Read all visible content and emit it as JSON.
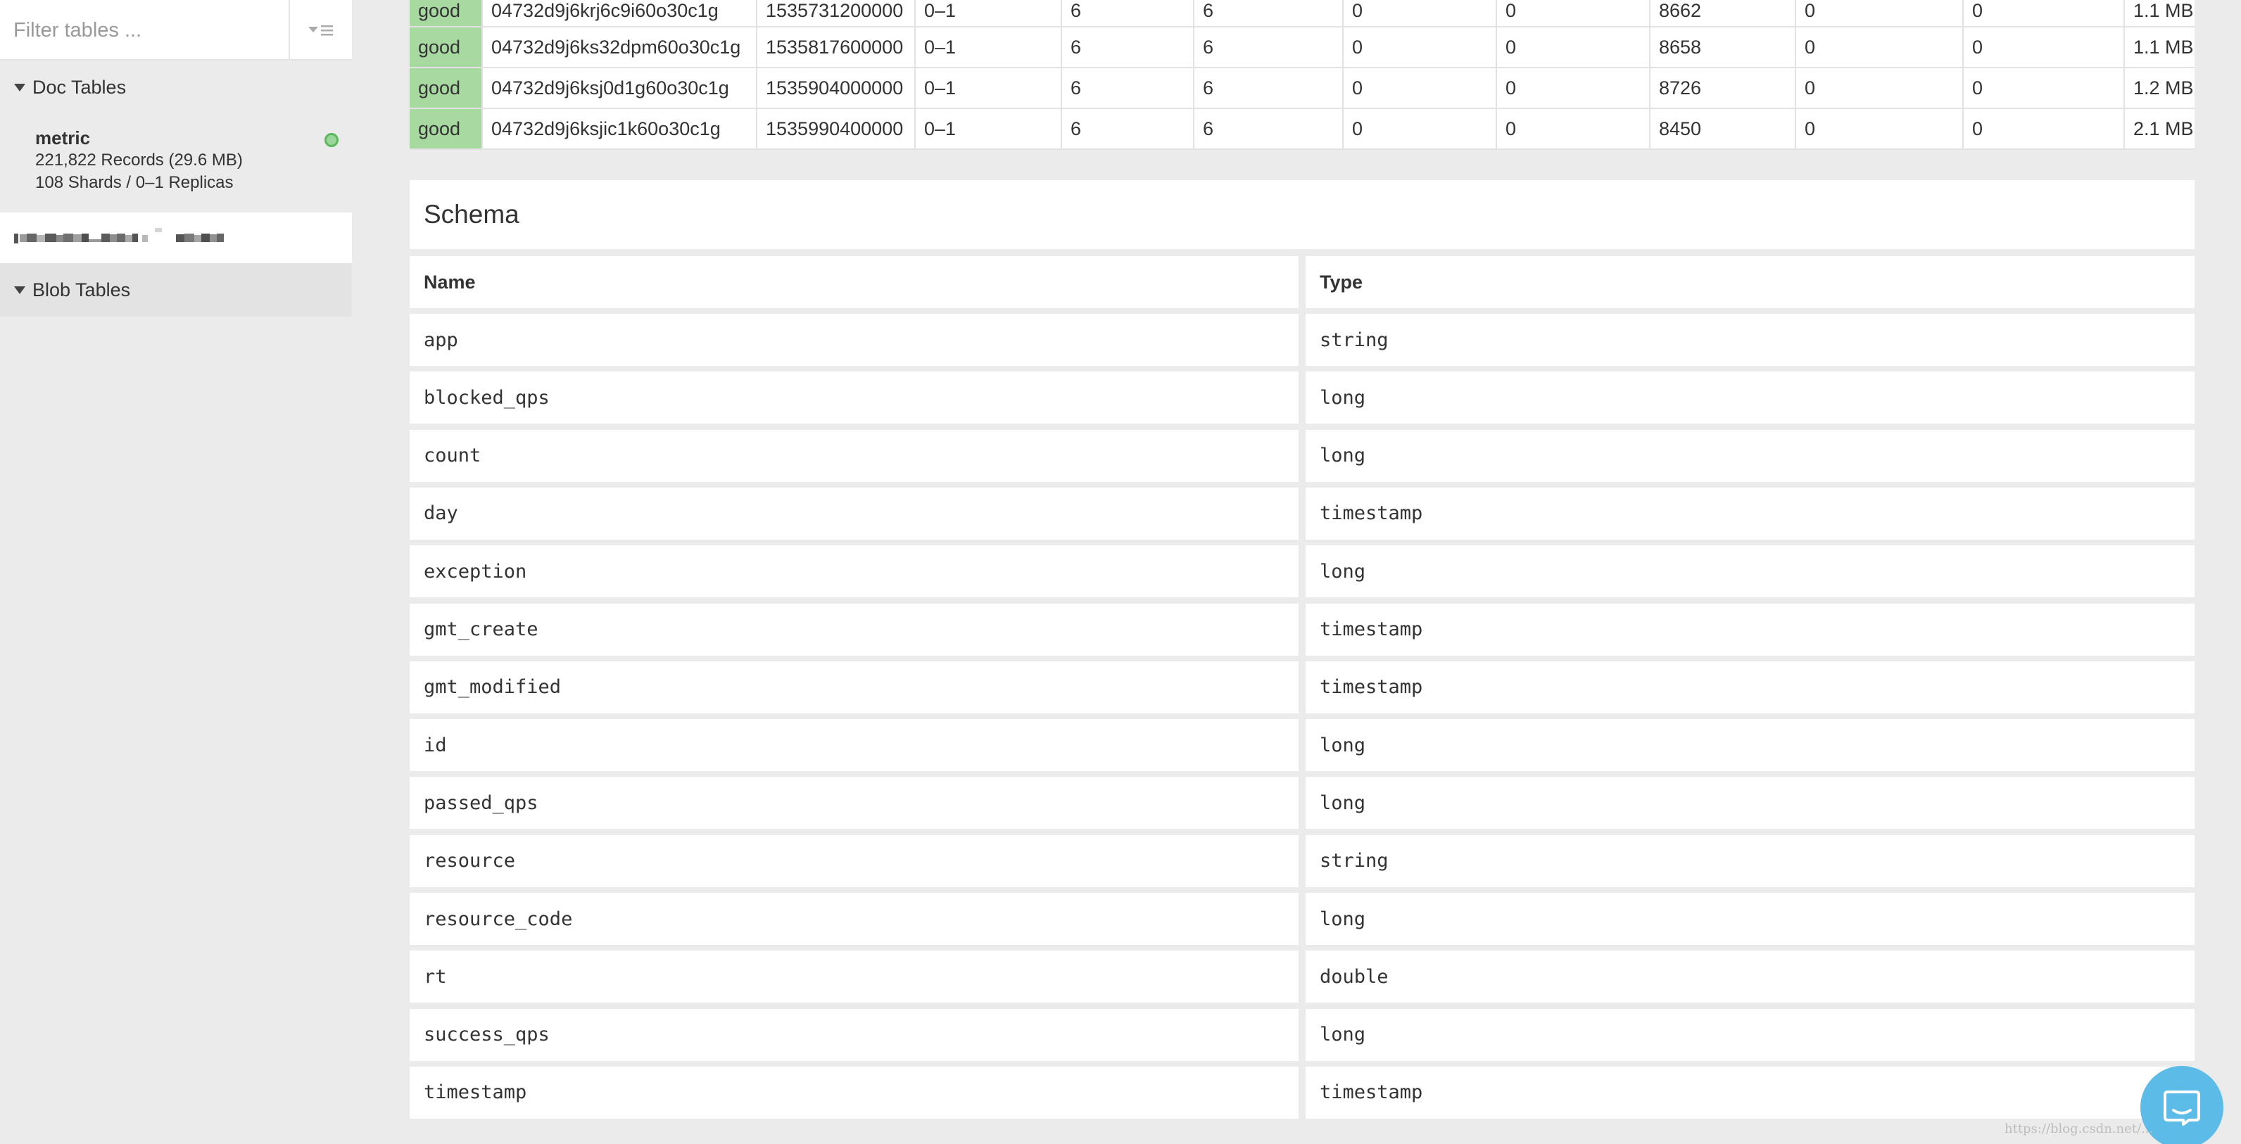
{
  "sidebar": {
    "filter_placeholder": "Filter tables ...",
    "doc_tables_label": "Doc Tables",
    "blob_tables_label": "Blob Tables",
    "tables": [
      {
        "name": "metric",
        "records": "221,822 Records (29.6 MB)",
        "shards": "108 Shards / 0–1 Replicas",
        "status_color": "#5cb85c"
      }
    ]
  },
  "shards_table": {
    "rows": [
      [
        "good",
        "04732d9j6krj6c9i60o30c1g",
        "1535731200000",
        "0–1",
        "6",
        "6",
        "0",
        "0",
        "8662",
        "0",
        "0",
        "1.1 MB"
      ],
      [
        "good",
        "04732d9j6ks32dpm60o30c1g",
        "1535817600000",
        "0–1",
        "6",
        "6",
        "0",
        "0",
        "8658",
        "0",
        "0",
        "1.1 MB"
      ],
      [
        "good",
        "04732d9j6ksj0d1g60o30c1g",
        "1535904000000",
        "0–1",
        "6",
        "6",
        "0",
        "0",
        "8726",
        "0",
        "0",
        "1.2 MB"
      ],
      [
        "good",
        "04732d9j6ksjic1k60o30c1g",
        "1535990400000",
        "0–1",
        "6",
        "6",
        "0",
        "0",
        "8450",
        "0",
        "0",
        "2.1 MB"
      ]
    ],
    "health_color": "#a8d9a1"
  },
  "schema": {
    "title": "Schema",
    "name_header": "Name",
    "type_header": "Type",
    "columns": [
      {
        "name": "app",
        "type": "string"
      },
      {
        "name": "blocked_qps",
        "type": "long"
      },
      {
        "name": "count",
        "type": "long"
      },
      {
        "name": "day",
        "type": "timestamp"
      },
      {
        "name": "exception",
        "type": "long"
      },
      {
        "name": "gmt_create",
        "type": "timestamp"
      },
      {
        "name": "gmt_modified",
        "type": "timestamp"
      },
      {
        "name": "id",
        "type": "long"
      },
      {
        "name": "passed_qps",
        "type": "long"
      },
      {
        "name": "resource",
        "type": "string"
      },
      {
        "name": "resource_code",
        "type": "long"
      },
      {
        "name": "rt",
        "type": "double"
      },
      {
        "name": "success_qps",
        "type": "long"
      },
      {
        "name": "timestamp",
        "type": "timestamp"
      }
    ]
  },
  "chat": {
    "icon": "chat-bubble-icon",
    "color": "#5dbbe8"
  },
  "watermark": "https://blog.csdn.net/..."
}
